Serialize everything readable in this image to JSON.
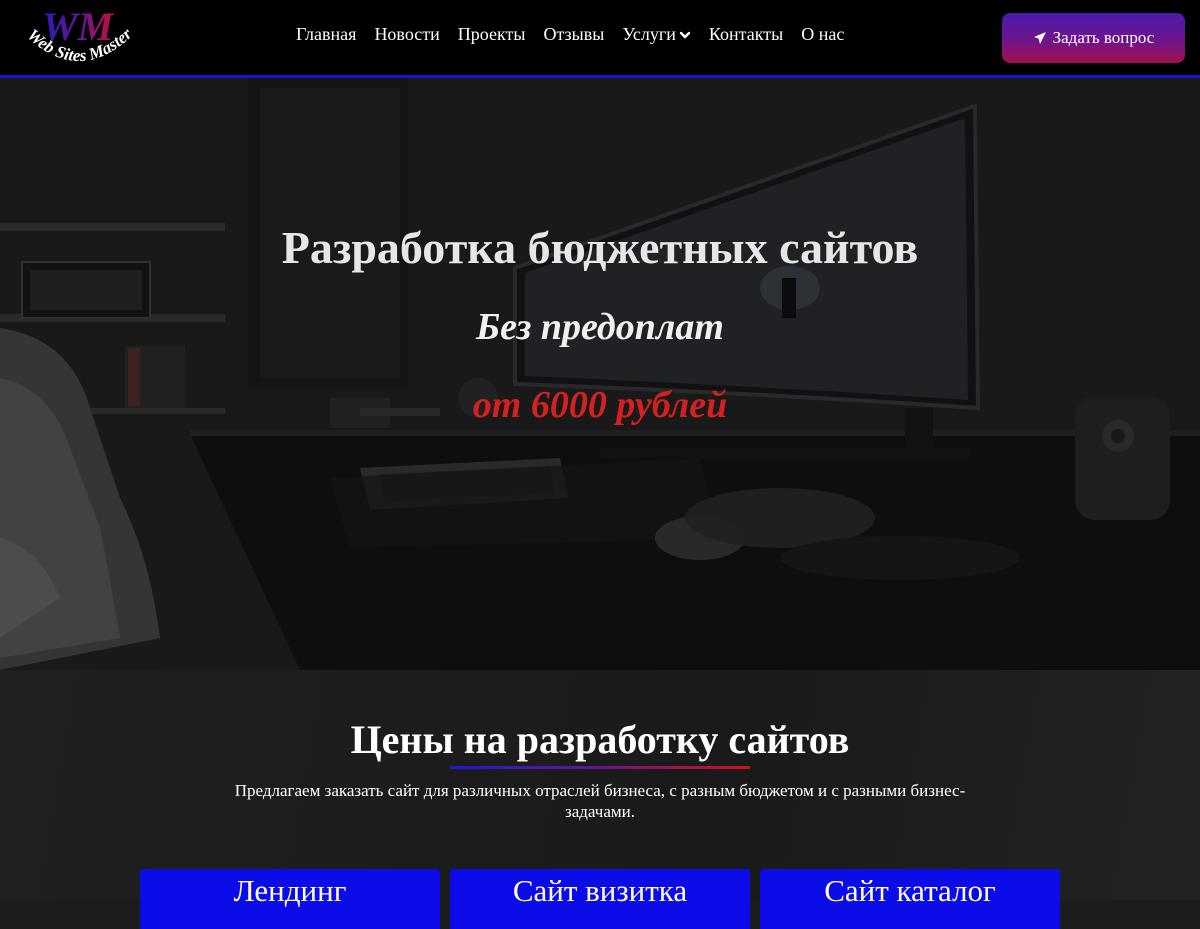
{
  "header": {
    "logo": {
      "monogram": "WM",
      "text": "Web Sites Master"
    },
    "nav": [
      {
        "label": "Главная"
      },
      {
        "label": "Новости"
      },
      {
        "label": "Проекты"
      },
      {
        "label": "Отзывы"
      },
      {
        "label": "Услуги",
        "has_dropdown": true
      },
      {
        "label": "Контакты"
      },
      {
        "label": "О нас"
      }
    ],
    "cta_label": "Задать вопрос",
    "cta_icon": "paper-plane-icon"
  },
  "hero": {
    "title": "Разработка бюджетных сайтов",
    "subtitle": "Без предоплат",
    "price": "от 6000 рублей"
  },
  "prices": {
    "title": "Цены на разработку сайтов",
    "description": "Предлагаем заказать сайт для различных отраслей бизнеса, с разным бюджетом и с разными бизнес-задачами.",
    "cards": [
      {
        "label": "Лендинг"
      },
      {
        "label": "Сайт визитка"
      },
      {
        "label": "Сайт каталог"
      }
    ]
  },
  "colors": {
    "accent_blue": "#0c0ce8",
    "header_border": "#1515d6",
    "price_red": "#d42020",
    "cta_gradient_top": "#4a1aa8",
    "cta_gradient_bottom": "#a0104e"
  }
}
